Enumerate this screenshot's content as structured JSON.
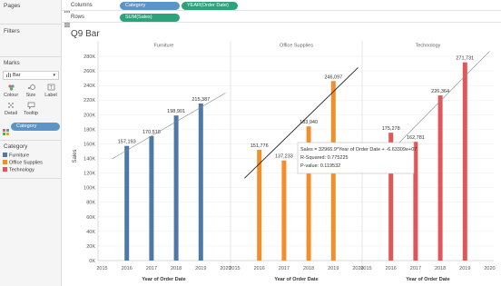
{
  "left_panel": {
    "pages_title": "Pages",
    "filters_title": "Filters",
    "marks": {
      "title": "Marks",
      "mark_type": "Bar",
      "buttons": [
        {
          "label": "Colour",
          "icon": "colour-icon"
        },
        {
          "label": "Size",
          "icon": "size-icon"
        },
        {
          "label": "Label",
          "icon": "label-icon"
        },
        {
          "label": "Detail",
          "icon": "detail-icon"
        },
        {
          "label": "Tooltip",
          "icon": "tooltip-icon"
        }
      ],
      "color_field": "Category"
    },
    "legend": {
      "title": "Category",
      "items": [
        {
          "label": "Furniture",
          "color": "#4e79a7"
        },
        {
          "label": "Office Supplies",
          "color": "#f28e2b"
        },
        {
          "label": "Technology",
          "color": "#e15759"
        }
      ]
    }
  },
  "shelves": {
    "columns_label": "Columns",
    "rows_label": "Rows",
    "columns_pills": [
      "Category",
      "YEAR(Order Date)"
    ],
    "rows_pills": [
      "SUM(Sales)"
    ]
  },
  "sheet_title": "Q9 Bar",
  "chart_data": {
    "type": "bar",
    "ylabel": "Sales",
    "xlabel": "Year of Order Date",
    "y_ticks": [
      "0K",
      "20K",
      "40K",
      "60K",
      "80K",
      "100K",
      "120K",
      "140K",
      "160K",
      "180K",
      "200K",
      "220K",
      "240K",
      "260K",
      "280K"
    ],
    "ylim": [
      0,
      290000
    ],
    "x_ticks": [
      "2015",
      "2016",
      "2017",
      "2018",
      "2019",
      "2020"
    ],
    "xlim": [
      2015,
      2020
    ],
    "panes": [
      {
        "header": "Furniture",
        "color": "#4e79a7",
        "years": [
          2016,
          2017,
          2018,
          2019
        ],
        "values": [
          157193,
          170518,
          198901,
          215387
        ],
        "labels": [
          "157,193",
          "170,518",
          "198,901",
          "215,387"
        ],
        "trend": {
          "slope": 19648,
          "intercept_year": 2015,
          "intercept": 131500
        }
      },
      {
        "header": "Office Supplies",
        "color": "#f28e2b",
        "years": [
          2016,
          2017,
          2018,
          2019
        ],
        "values": [
          151776,
          137233,
          183940,
          246097
        ],
        "labels": [
          "151,776",
          "137,233",
          "183,940",
          "246,097"
        ],
        "trend": {
          "slope": 32966.9,
          "intercept_year": 2015,
          "intercept": 99700
        }
      },
      {
        "header": "Technology",
        "color": "#e15759",
        "years": [
          2016,
          2017,
          2018,
          2019
        ],
        "values": [
          175278,
          162781,
          226364,
          271731
        ],
        "labels": [
          "175,278",
          "162,781",
          "226,364",
          "271,731"
        ],
        "trend": {
          "slope": 34200,
          "intercept_year": 2015,
          "intercept": 116000
        }
      }
    ],
    "grid": true,
    "tooltip": {
      "lines": [
        "Sales = 32966.9*Year of Order Date + -6.63309e+07",
        "R-Squared: 0.775225",
        "P-value: 0.119532"
      ]
    }
  }
}
